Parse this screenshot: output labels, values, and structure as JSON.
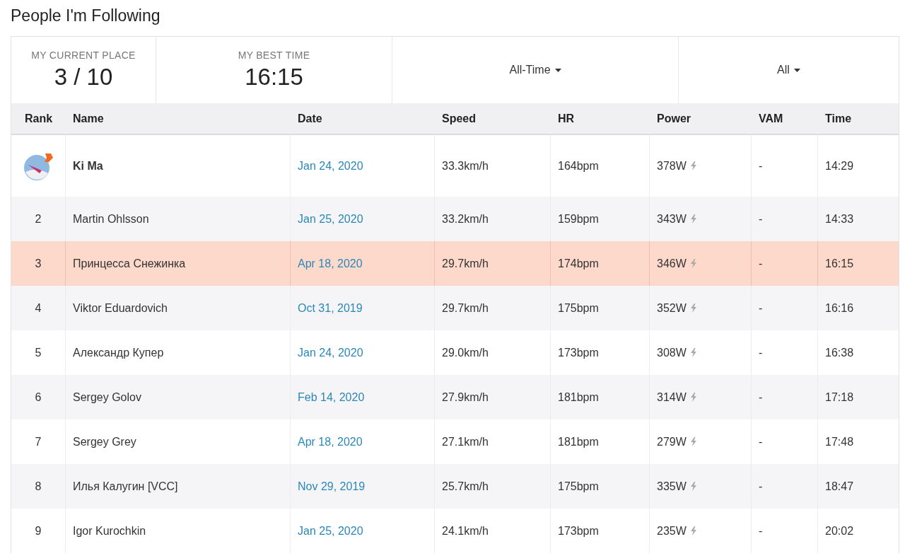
{
  "title": "People I'm Following",
  "summary": {
    "place_label": "MY CURRENT PLACE",
    "place_value": "3 / 10",
    "best_label": "MY BEST TIME",
    "best_value": "16:15",
    "filters": [
      {
        "label": "All-Time"
      },
      {
        "label": "All"
      }
    ]
  },
  "table": {
    "columns": [
      "Rank",
      "Name",
      "Date",
      "Speed",
      "HR",
      "Power",
      "VAM",
      "Time"
    ],
    "rows": [
      {
        "kind": "avatar",
        "name": "Ki Ma",
        "bold": true,
        "current": false,
        "date": "Jan 24, 2020",
        "speed": "33.3km/h",
        "hr": "164bpm",
        "power": "378W",
        "vam": "-",
        "time": "14:29"
      },
      {
        "kind": "number",
        "rank": "2",
        "name": "Martin Ohlsson",
        "bold": false,
        "current": false,
        "date": "Jan 25, 2020",
        "speed": "33.2km/h",
        "hr": "159bpm",
        "power": "343W",
        "vam": "-",
        "time": "14:33"
      },
      {
        "kind": "number",
        "rank": "3",
        "name": "Принцесса Снежинка",
        "bold": false,
        "current": true,
        "date": "Apr 18, 2020",
        "speed": "29.7km/h",
        "hr": "174bpm",
        "power": "346W",
        "vam": "-",
        "time": "16:15"
      },
      {
        "kind": "number",
        "rank": "4",
        "name": "Viktor Eduardovich",
        "bold": false,
        "current": false,
        "date": "Oct 31, 2019",
        "speed": "29.7km/h",
        "hr": "175bpm",
        "power": "352W",
        "vam": "-",
        "time": "16:16"
      },
      {
        "kind": "number",
        "rank": "5",
        "name": "Александр Купер",
        "bold": false,
        "current": false,
        "date": "Jan 24, 2020",
        "speed": "29.0km/h",
        "hr": "173bpm",
        "power": "308W",
        "vam": "-",
        "time": "16:38"
      },
      {
        "kind": "number",
        "rank": "6",
        "name": "Sergey Golov",
        "bold": false,
        "current": false,
        "date": "Feb 14, 2020",
        "speed": "27.9km/h",
        "hr": "181bpm",
        "power": "314W",
        "vam": "-",
        "time": "17:18"
      },
      {
        "kind": "number",
        "rank": "7",
        "name": "Sergey Grey",
        "bold": false,
        "current": false,
        "date": "Apr 18, 2020",
        "speed": "27.1km/h",
        "hr": "181bpm",
        "power": "279W",
        "vam": "-",
        "time": "17:48"
      },
      {
        "kind": "number",
        "rank": "8",
        "name": "Илья Калугин [VCC]",
        "bold": false,
        "current": false,
        "date": "Nov 29, 2019",
        "speed": "25.7km/h",
        "hr": "175bpm",
        "power": "335W",
        "vam": "-",
        "time": "18:47"
      },
      {
        "kind": "number",
        "rank": "9",
        "name": "Igor Kurochkin",
        "bold": false,
        "current": false,
        "date": "Jan 25, 2020",
        "speed": "24.1km/h",
        "hr": "173bpm",
        "power": "235W",
        "vam": "-",
        "time": "20:02"
      }
    ]
  }
}
